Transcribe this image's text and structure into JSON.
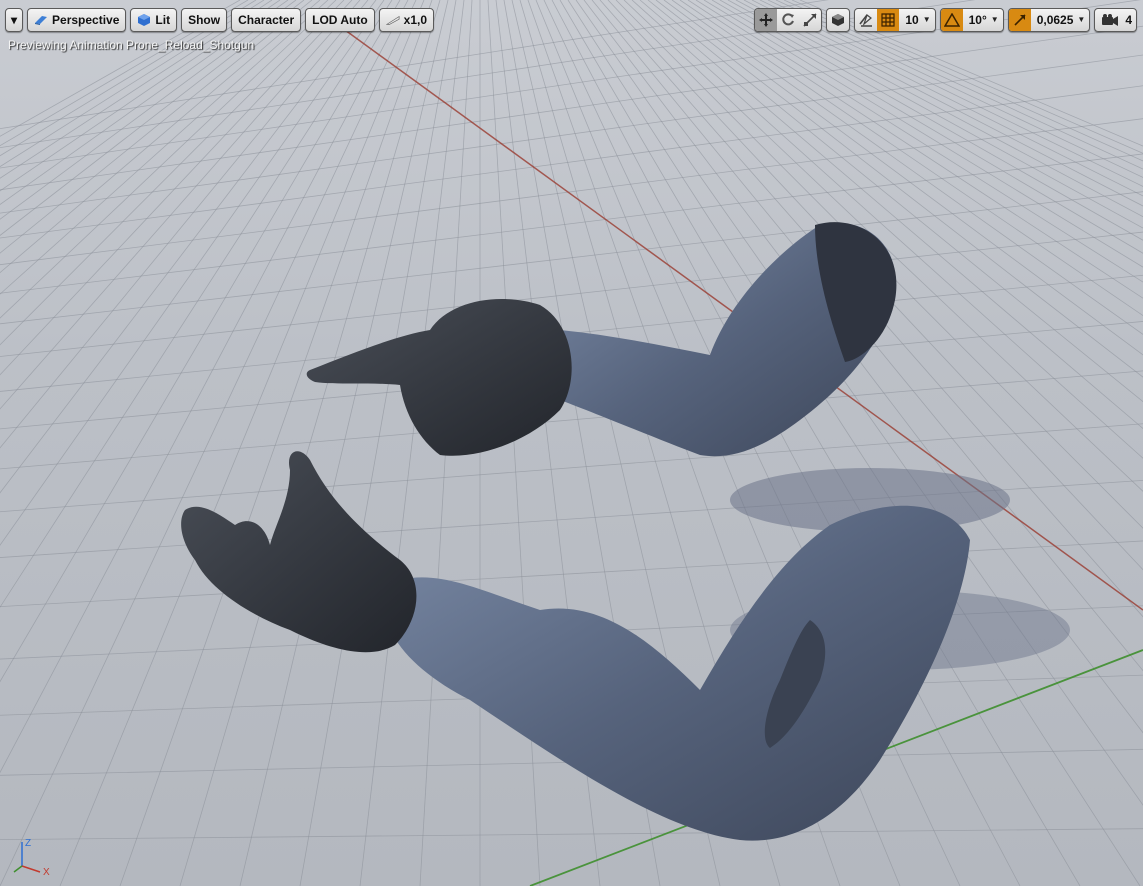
{
  "toolbar_left": {
    "menu_caret": "▾",
    "view_mode": "Perspective",
    "lighting": "Lit",
    "show": "Show",
    "character": "Character",
    "lod": "LOD Auto",
    "playback_speed": "x1,0"
  },
  "toolbar_right": {
    "grid_snap": "10",
    "rotation_snap": "10°",
    "scale_snap": "0,0625",
    "camera_speed": "4"
  },
  "status": "Previewing Animation Prone_Reload_Shotgun",
  "axis": {
    "z": "Z",
    "x": "X"
  },
  "colors": {
    "snap_active": "#d88a12",
    "x_axis": "#9a3b30",
    "y_axis": "#3f8f2e",
    "viewport_bg": "#bcc0c7"
  }
}
